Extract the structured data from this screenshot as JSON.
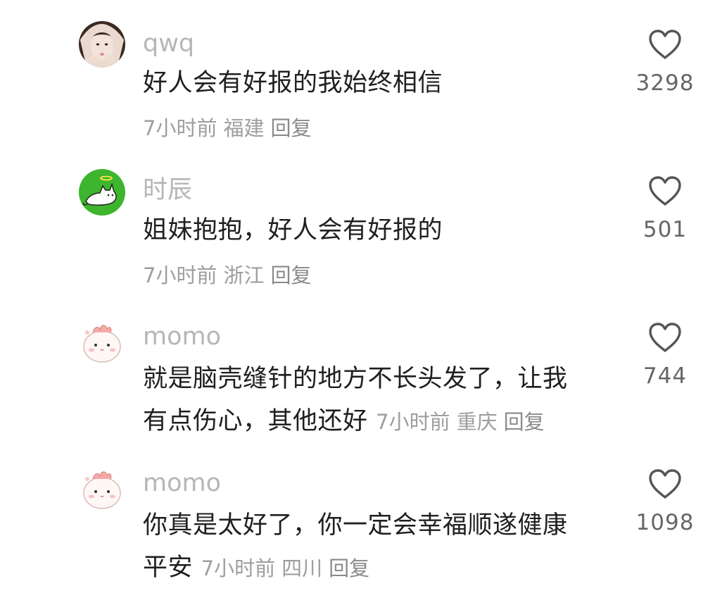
{
  "comments": [
    {
      "username": "qwq",
      "avatar": "photo-avatar-girl",
      "text": "好人会有好报的我始终相信",
      "time": "7小时前",
      "location": "福建",
      "reply_label": "回复",
      "likes": "3298",
      "like_icon": "heart-outline-icon"
    },
    {
      "username": "时辰",
      "avatar": "green-cat-avatar",
      "text": "姐妹抱抱，好人会有好报的",
      "time": "7小时前",
      "location": "浙江",
      "reply_label": "回复",
      "likes": "501",
      "like_icon": "heart-outline-icon"
    },
    {
      "username": "momo",
      "avatar": "pink-cartoon-avatar",
      "text_line1": "就是脑壳缝针的地方不长头发了，让我",
      "text_line2": "有点伤心，其他还好",
      "time": "7小时前",
      "location": "重庆",
      "reply_label": "回复",
      "likes": "744",
      "like_icon": "heart-outline-icon"
    },
    {
      "username": "momo",
      "avatar": "pink-cartoon-avatar",
      "text_line1": "你真是太好了，你一定会幸福顺遂健康",
      "text_line2": "平安",
      "time": "7小时前",
      "location": "四川",
      "reply_label": "回复",
      "likes": "1098",
      "like_icon": "heart-outline-icon"
    }
  ],
  "colors": {
    "username": "#b6b6b6",
    "text": "#1f1f1f",
    "meta": "#9e9e9e",
    "count": "#666666",
    "avatar_green": "#3db52e",
    "avatar_pink": "#f7c9c9"
  }
}
